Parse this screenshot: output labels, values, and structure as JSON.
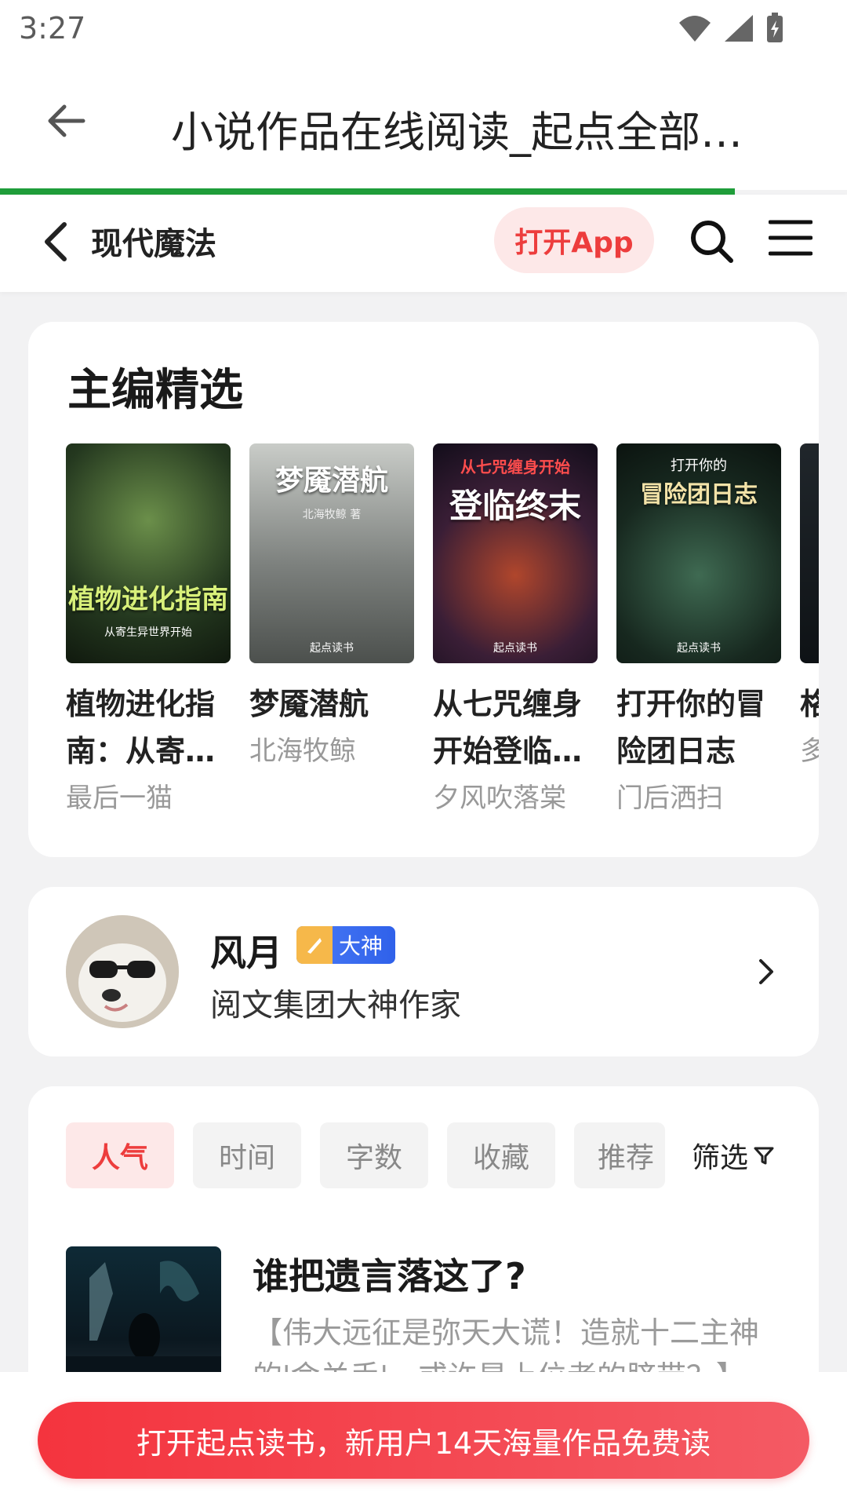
{
  "status_bar": {
    "time": "3:27"
  },
  "browser": {
    "page_title": "小说作品在线阅读_起点全部…"
  },
  "site_header": {
    "category": "现代魔法",
    "open_app_label": "打开App"
  },
  "editor_picks": {
    "title": "主编精选",
    "books": [
      {
        "name": "植物进化指南：从寄…",
        "author": "最后一猫",
        "cover_title": "植物进化指南",
        "cover_subtitle": "从寄生异世界开始"
      },
      {
        "name": "梦魇潜航",
        "author": "北海牧鲸",
        "cover_title": "梦魇潜航",
        "cover_subtitle": "北海牧鲸 著"
      },
      {
        "name": "从七咒缠身开始登临…",
        "author": "夕风吹落棠",
        "cover_title": "登临终末",
        "cover_subtitle": "从七咒缠身开始"
      },
      {
        "name": "打开你的冒险团日志",
        "author": "门后洒扫",
        "cover_title": "冒险团日志",
        "cover_subtitle": "打开你的"
      },
      {
        "name": "格…师",
        "author": "多…",
        "cover_title": "",
        "cover_subtitle": ""
      }
    ],
    "cover_brand": "起点读书"
  },
  "author_card": {
    "name": "风月",
    "badge": "大神",
    "subtitle": "阅文集团大神作家"
  },
  "sort_tabs": [
    "人气",
    "时间",
    "字数",
    "收藏",
    "推荐"
  ],
  "filter_label": "筛选",
  "list_item": {
    "title": "谁把遗言落这了?",
    "description": "【伟大远征是弥天大谎！造就十二主神的'命关手'，或许是上位者的脐带？】"
  },
  "cta_label": "打开起点读书，新用户14天海量作品免费读"
}
